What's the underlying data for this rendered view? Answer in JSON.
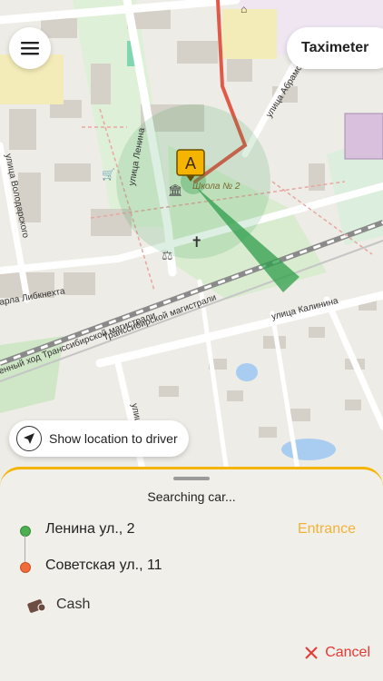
{
  "map": {
    "street_labels": [
      "улица Ленина",
      "улица Абрамов",
      "улица Володарского",
      "улица Калинина",
      "арла Либкнехта",
      "Транссибирской магистрали",
      "енный ход Транссибирской магистрали",
      "улица"
    ],
    "poi_label": "Школа № 2",
    "marker_label": "A",
    "accent_color": "#f4b400",
    "route_color": "#e05a4a",
    "cone_color": "#2e9e4a"
  },
  "header": {
    "menu_icon": "hamburger-icon",
    "taximeter_label": "Taximeter"
  },
  "share_location": {
    "icon": "location-arrow-icon",
    "label": "Show location to driver"
  },
  "sheet": {
    "status": "Searching car...",
    "origin": {
      "address": "Ленина ул., 2",
      "dot_color": "#4caf50"
    },
    "entrance_label": "Entrance",
    "destination": {
      "address": "Советская ул., 11",
      "dot_color": "#f26b3a"
    },
    "payment": {
      "icon": "cash-icon",
      "label": "Cash"
    },
    "cancel": {
      "icon": "close-icon",
      "label": "Cancel",
      "color": "#e53935"
    }
  }
}
